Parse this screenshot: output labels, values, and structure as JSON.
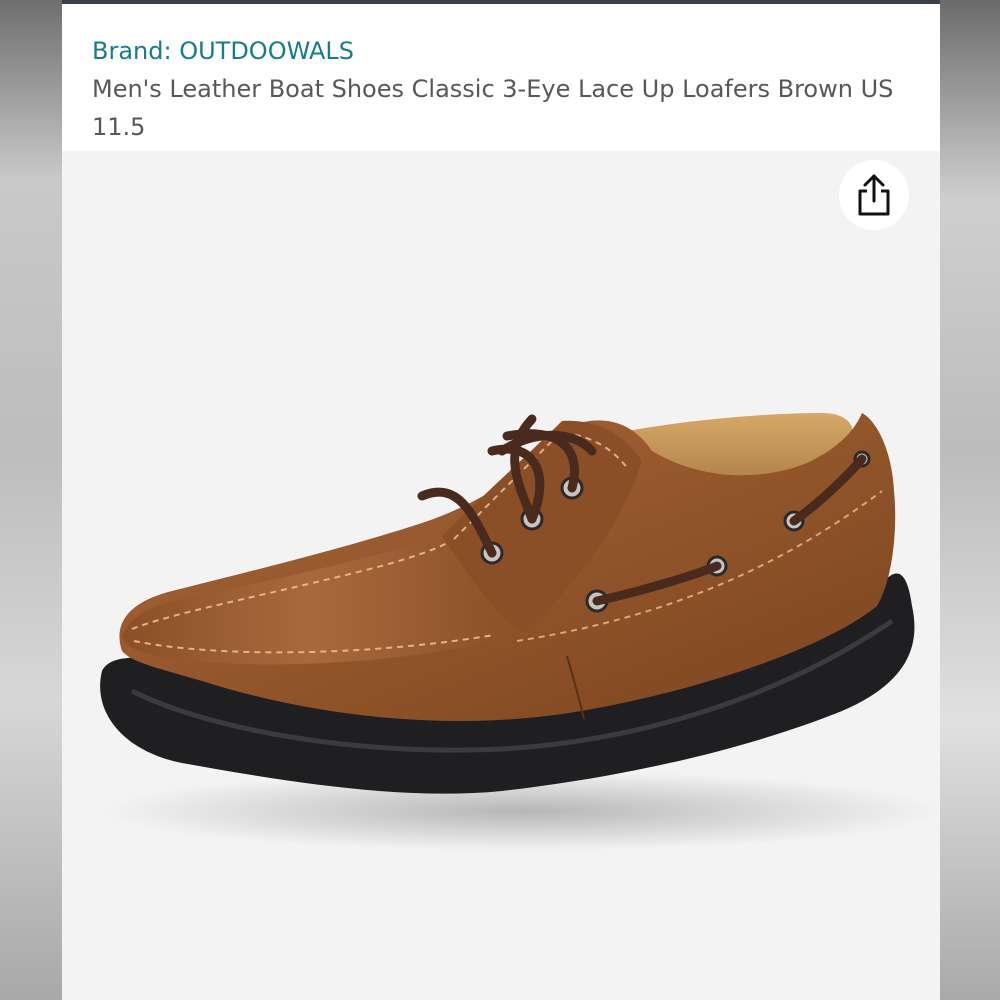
{
  "product": {
    "brand_line": "Brand: OUTDOOWALS",
    "title": "Men's Leather Boat Shoes Classic 3-Eye Lace Up Loafers Brown US 11.5"
  },
  "image": {
    "alt": "Brown leather boat shoe with black sole",
    "share_icon": "share-icon"
  },
  "colors": {
    "brand_link": "#167c8a",
    "title_text": "#565959",
    "leather": "#9a5a2c",
    "sole": "#1f1f22"
  }
}
